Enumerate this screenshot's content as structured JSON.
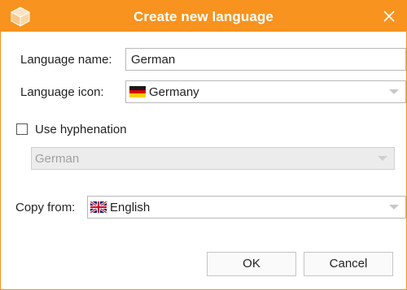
{
  "dialog": {
    "title": "Create new language",
    "app_icon": "cube-icon",
    "close_icon": "close-icon"
  },
  "form": {
    "language_name": {
      "label": "Language name:",
      "value": "German"
    },
    "language_icon": {
      "label": "Language icon:",
      "value": "Germany",
      "flag_icon": "germany-flag-icon"
    },
    "use_hyphenation": {
      "label": "Use hyphenation",
      "checked": false
    },
    "hyphenation_language": {
      "value": "German",
      "disabled": true
    },
    "copy_from": {
      "label": "Copy from:",
      "value": "English",
      "flag_icon": "uk-flag-icon"
    }
  },
  "buttons": {
    "ok": "OK",
    "cancel": "Cancel"
  },
  "colors": {
    "accent": "#f7931e",
    "disabled_bg": "#ececec"
  }
}
